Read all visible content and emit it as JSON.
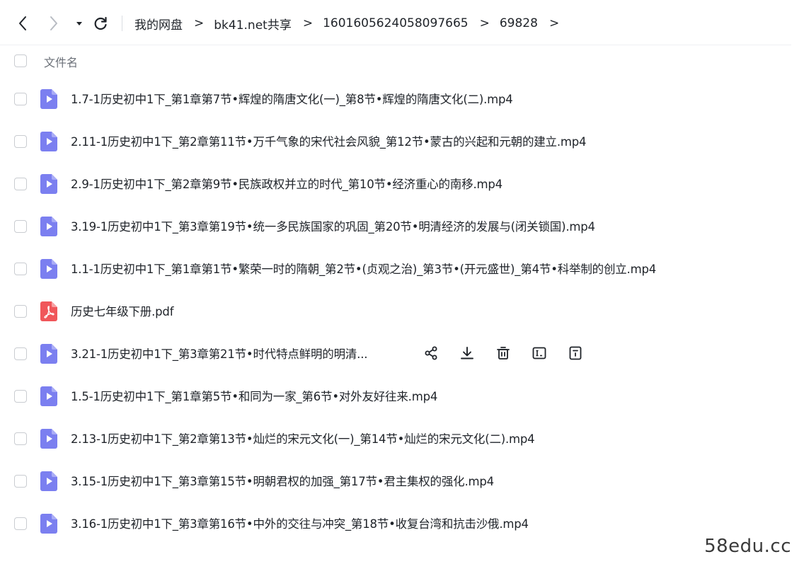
{
  "breadcrumb": {
    "items": [
      "我的网盘",
      "bk41.net共享",
      "1601605624058097665",
      "69828"
    ],
    "separator": ">"
  },
  "header": {
    "column_name": "文件名"
  },
  "files": [
    {
      "name": "1.7-1历史初中1下_第1章第7节•辉煌的隋唐文化(一)_第8节•辉煌的隋唐文化(二).mp4",
      "type": "video"
    },
    {
      "name": "2.11-1历史初中1下_第2章第11节•万千气象的宋代社会风貌_第12节•蒙古的兴起和元朝的建立.mp4",
      "type": "video"
    },
    {
      "name": "2.9-1历史初中1下_第2章第9节•民族政权并立的时代_第10节•经济重心的南移.mp4",
      "type": "video"
    },
    {
      "name": "3.19-1历史初中1下_第3章第19节•统一多民族国家的巩固_第20节•明清经济的发展与(闭关锁国).mp4",
      "type": "video"
    },
    {
      "name": "1.1-1历史初中1下_第1章第1节•繁荣一时的隋朝_第2节•(贞观之治)_第3节•(开元盛世)_第4节•科举制的创立.mp4",
      "type": "video"
    },
    {
      "name": "历史七年级下册.pdf",
      "type": "pdf"
    },
    {
      "name": "3.21-1历史初中1下_第3章第21节•时代特点鲜明的明清...",
      "type": "video",
      "hovered": true
    },
    {
      "name": "1.5-1历史初中1下_第1章第5节•和同为一家_第6节•对外友好往来.mp4",
      "type": "video"
    },
    {
      "name": "2.13-1历史初中1下_第2章第13节•灿烂的宋元文化(一)_第14节•灿烂的宋元文化(二).mp4",
      "type": "video"
    },
    {
      "name": "3.15-1历史初中1下_第3章第15节•明朝君权的加强_第17节•君主集权的强化.mp4",
      "type": "video"
    },
    {
      "name": "3.16-1历史初中1下_第3章第16节•中外的交往与冲突_第18节•收复台湾和抗击沙俄.mp4",
      "type": "video"
    }
  ],
  "row_actions": [
    "share-icon",
    "download-icon",
    "delete-icon",
    "rename-icon",
    "details-icon"
  ],
  "watermark": "58edu.cc",
  "colors": {
    "video_icon": "#7b7ff0",
    "pdf_icon": "#f0565a",
    "text": "#1f2329"
  }
}
